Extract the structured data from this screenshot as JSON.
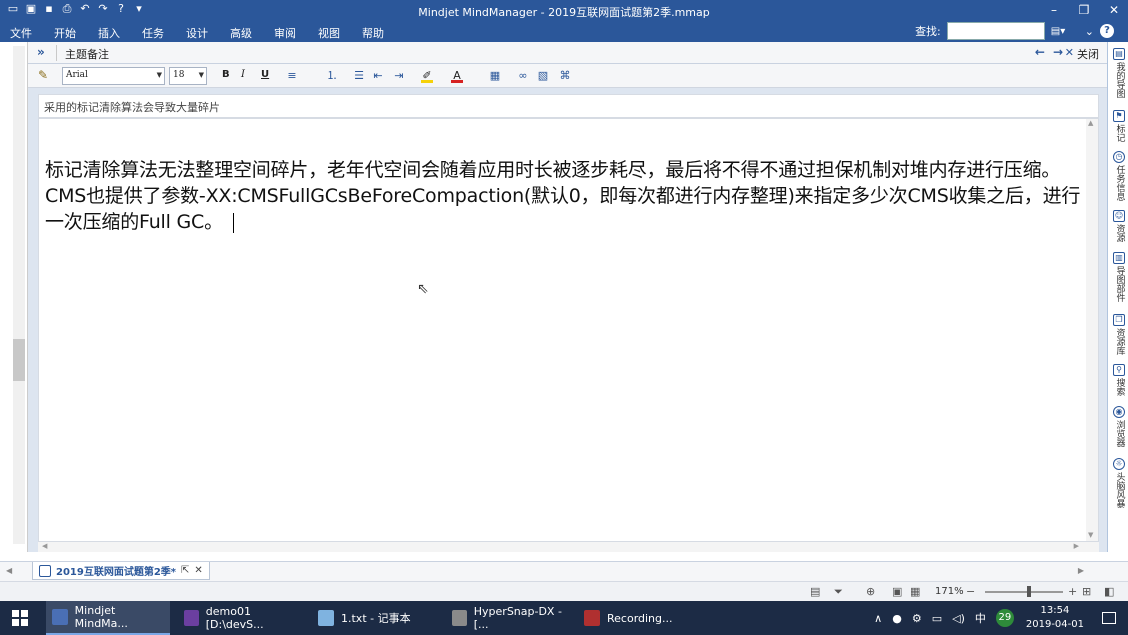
{
  "window": {
    "title": "Mindjet MindManager - 2019互联网面试题第2季.mmap",
    "minimize_glyph": "–",
    "restore_glyph": "❐",
    "close_glyph": "✕"
  },
  "menu": {
    "items": [
      "文件",
      "开始",
      "插入",
      "任务",
      "设计",
      "高级",
      "审阅",
      "视图",
      "帮助"
    ],
    "search_label": "查找:",
    "search_value": ""
  },
  "panel": {
    "title": "主题备注",
    "close_label": "关闭",
    "font": "Arial",
    "size": "18",
    "bold": "B",
    "italic": "I",
    "underline": "U",
    "highlight_color": "#f5d10a",
    "font_color": "#d62222"
  },
  "note": {
    "subject": "采用的标记清除算法会导致大量碎片",
    "body": "标记清除算法无法整理空间碎片，老年代空间会随着应用时长被逐步耗尽，最后将不得不通过担保机制对堆内存进行压缩。CMS也提供了参数-XX:CMSFullGCsBeForeCompaction(默认0，即每次都进行内存整理)来指定多少次CMS收集之后，进行一次压缩的Full GC。"
  },
  "right_sidebar": [
    {
      "label": "我的导图",
      "icon": "map-icon"
    },
    {
      "label": "标记",
      "icon": "tag-icon"
    },
    {
      "label": "任务信息",
      "icon": "task-icon"
    },
    {
      "label": "资源",
      "icon": "resource-icon"
    },
    {
      "label": "导图部件",
      "icon": "parts-icon"
    },
    {
      "label": "资源库",
      "icon": "library-icon"
    },
    {
      "label": "搜索",
      "icon": "search-icon"
    },
    {
      "label": "浏览器",
      "icon": "browser-icon"
    },
    {
      "label": "头脑风暴",
      "icon": "bulb-icon"
    }
  ],
  "doc_tab": {
    "label": "2019互联网面试题第2季*"
  },
  "status": {
    "zoom": "171%"
  },
  "taskbar": {
    "apps": [
      {
        "label": "Mindjet MindMa...",
        "color": "#d9534f"
      },
      {
        "label": "demo01 [D:\\devS...",
        "color": "#6b3fa0"
      },
      {
        "label": "1.txt - 记事本",
        "color": "#7fb3e0"
      },
      {
        "label": "HyperSnap-DX - [...",
        "color": "#8a8a8a"
      },
      {
        "label": "Recording...",
        "color": "#b03030"
      }
    ],
    "ime": "中",
    "badge": "29",
    "time": "13:54",
    "date": "2019-04-01"
  }
}
